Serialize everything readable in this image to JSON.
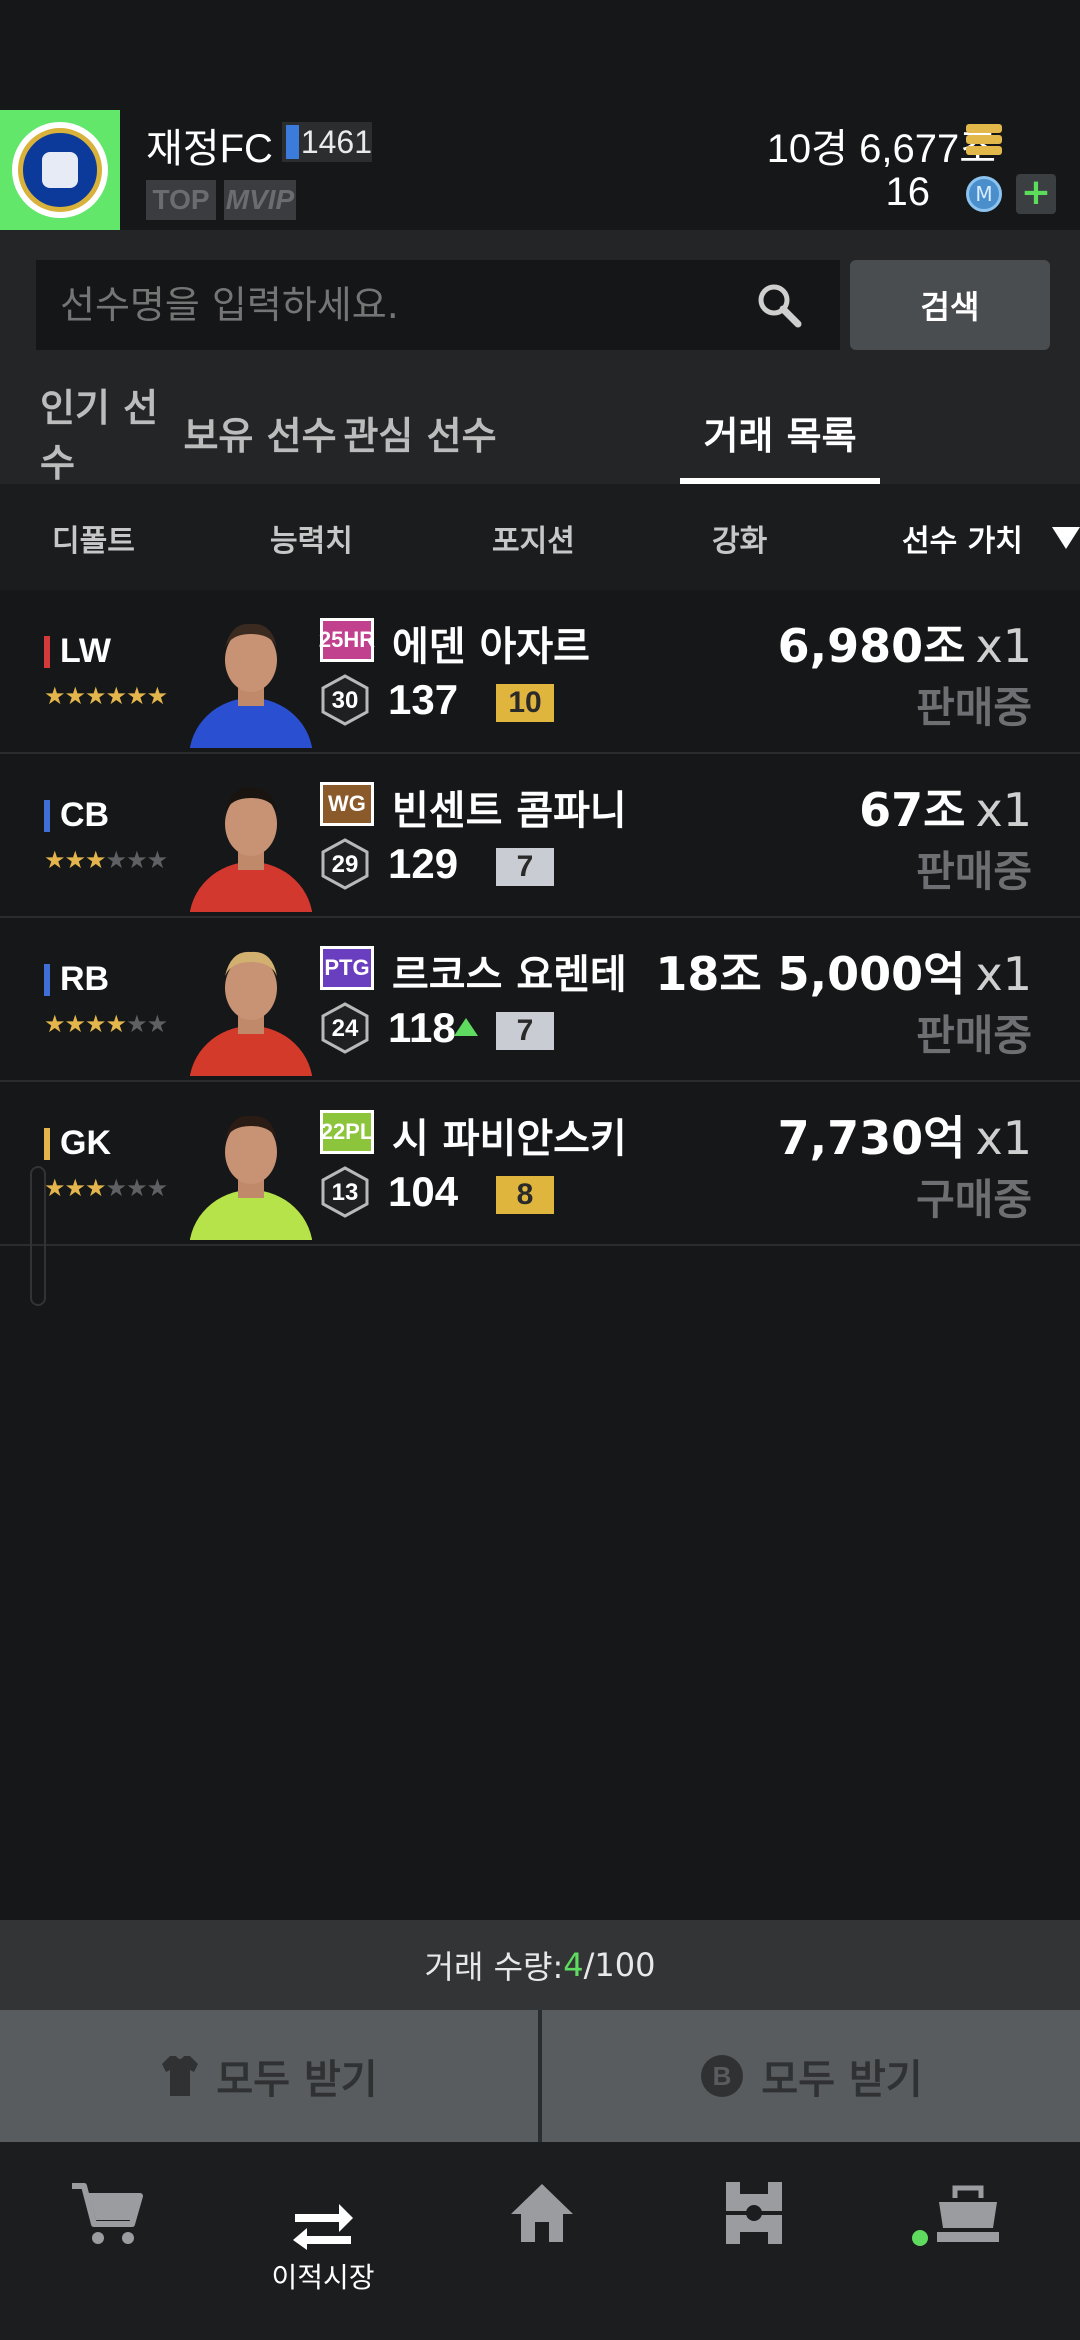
{
  "header": {
    "club_name": "재정FC",
    "club_level": "1461",
    "tag_top": "TOP",
    "tag_vip": "VIP",
    "money": "10경 6,677조",
    "mcoin": "16",
    "plus": "+"
  },
  "search": {
    "placeholder": "선수명을 입력하세요.",
    "button": "검색"
  },
  "tabs": [
    "인기 선수",
    "보유 선수",
    "관심 선수",
    "거래 목록"
  ],
  "active_tab": "거래 목록",
  "sort": [
    "디폴트",
    "능력치",
    "포지션",
    "강화",
    "선수 가치"
  ],
  "active_sort": "선수 가치",
  "players": [
    {
      "pos": "LW",
      "pos_color": "#d33a3a",
      "stars": 6,
      "season": "25HR",
      "season_bg": "#c2418e",
      "name": "에덴 아자르",
      "level": "30",
      "ovr": "137",
      "upgrade": false,
      "grade": "10",
      "grade_bg": "#e0b53e",
      "price": "6,980조",
      "mult": "x1",
      "status": "판매중"
    },
    {
      "pos": "CB",
      "pos_color": "#3d6fd6",
      "stars": 3,
      "season": "WG",
      "season_bg": "#8a5a2a",
      "name": "빈센트 콤파니",
      "level": "29",
      "ovr": "129",
      "upgrade": false,
      "grade": "7",
      "grade_bg": "#c9ccd2",
      "price": "67조",
      "mult": "x1",
      "status": "판매중"
    },
    {
      "pos": "RB",
      "pos_color": "#3d6fd6",
      "stars": 4,
      "season": "PTG",
      "season_bg": "#6a3fbf",
      "name": "르코스 요렌테",
      "level": "24",
      "ovr": "118",
      "upgrade": true,
      "grade": "7",
      "grade_bg": "#c9ccd2",
      "price": "18조 5,000억",
      "mult": "x1",
      "status": "판매중"
    },
    {
      "pos": "GK",
      "pos_color": "#e3b54c",
      "stars": 3,
      "season": "22PL",
      "season_bg": "#8cc43c",
      "name": "시 파비안스키",
      "level": "13",
      "ovr": "104",
      "upgrade": false,
      "grade": "8",
      "grade_bg": "#e0b53e",
      "price": "7,730억",
      "mult": "x1",
      "status": "구매중"
    }
  ],
  "footer": {
    "qty_label": "거래 수량: ",
    "qty_num": "4",
    "qty_total": "/100",
    "receive_all_1": "모두 받기",
    "receive_all_2": "모두 받기"
  },
  "nav": {
    "transfer_label": "이적시장"
  }
}
